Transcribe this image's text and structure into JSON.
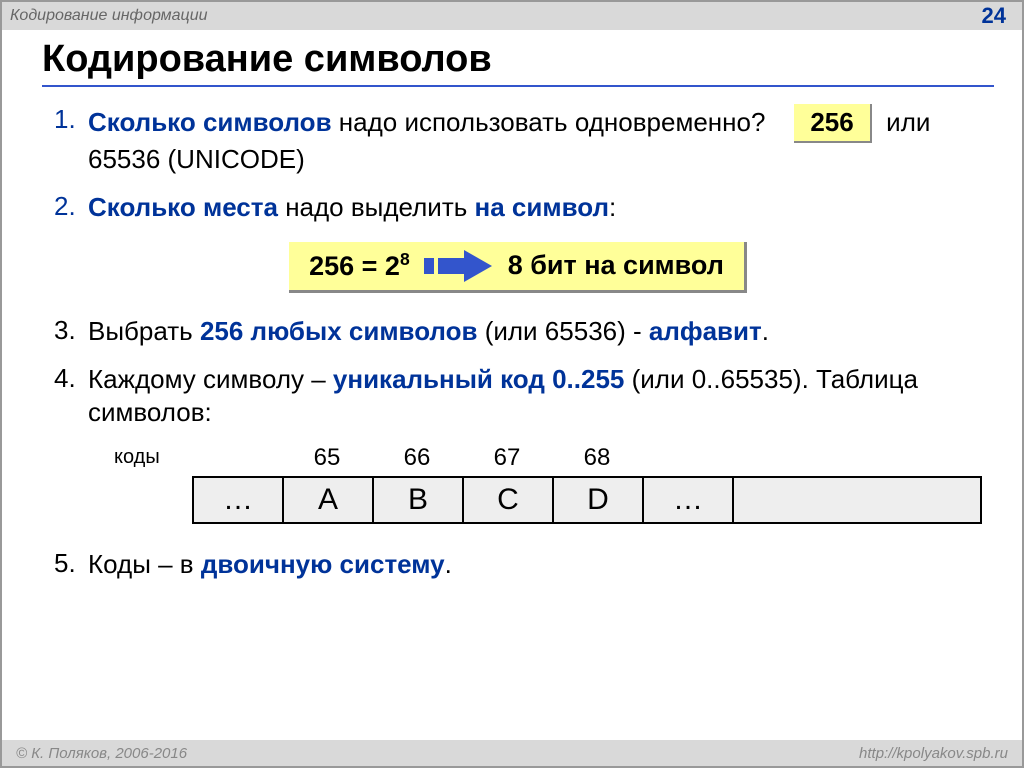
{
  "header": {
    "topic": "Кодирование информации",
    "page": "24"
  },
  "title": "Кодирование символов",
  "list": {
    "n1": "1.",
    "q1a": "Сколько символов",
    "q1b": " надо использовать одновременно?",
    "box1": "256",
    "q1c": " или 65536 (UNICODE)",
    "n2": "2.",
    "q2a": "Сколько места",
    "q2b": " надо выделить ",
    "q2c": "на символ",
    "q2d": ":",
    "formula_lhs": "256 = 2",
    "formula_exp": "8",
    "formula_rhs": "8 бит на символ",
    "n3": "3.",
    "q3a": "Выбрать ",
    "q3b": "256 любых символов",
    "q3c": " (или 65536) - ",
    "q3d": "алфавит",
    "q3e": ".",
    "n4": "4.",
    "q4a": "Каждому символу – ",
    "q4b": "уникальный код 0..255",
    "q4c": " (или 0..65535). Таблица символов:",
    "codes_label": "коды",
    "codes": [
      "65",
      "66",
      "67",
      "68"
    ],
    "chars": [
      "…",
      "A",
      "B",
      "C",
      "D",
      "…",
      ""
    ],
    "n5": "5.",
    "q5a": "Коды – в ",
    "q5b": "двоичную систему",
    "q5c": "."
  },
  "footer": {
    "left": "© К. Поляков, 2006-2016",
    "right": "http://kpolyakov.spb.ru"
  }
}
